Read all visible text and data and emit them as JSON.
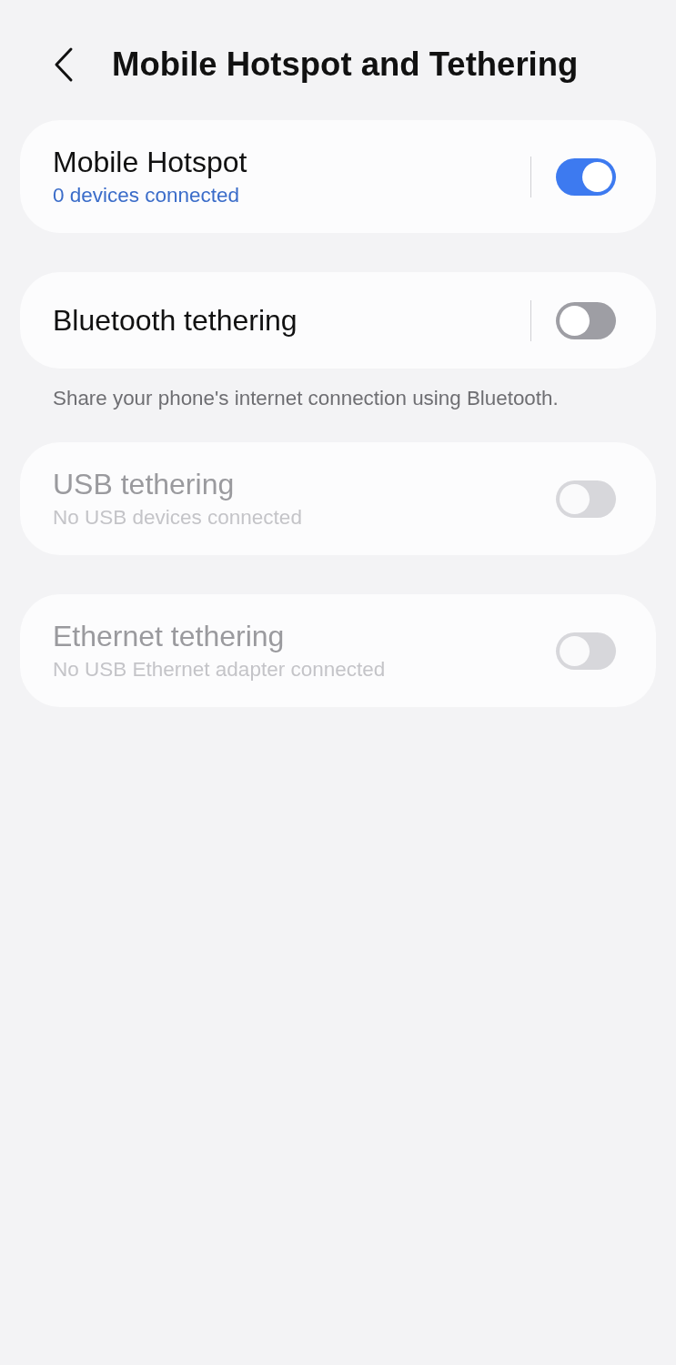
{
  "header": {
    "title": "Mobile Hotspot and Tethering"
  },
  "settings": [
    {
      "title": "Mobile Hotspot",
      "subtitle": "0 devices connected",
      "on": true,
      "disabled": false
    },
    {
      "title": "Bluetooth tethering",
      "on": false,
      "disabled": false,
      "description": "Share your phone's internet connection using Bluetooth."
    },
    {
      "title": "USB tethering",
      "subtitle": "No USB devices connected",
      "on": false,
      "disabled": true
    },
    {
      "title": "Ethernet tethering",
      "subtitle": "No USB Ethernet adapter connected",
      "on": false,
      "disabled": true
    }
  ]
}
